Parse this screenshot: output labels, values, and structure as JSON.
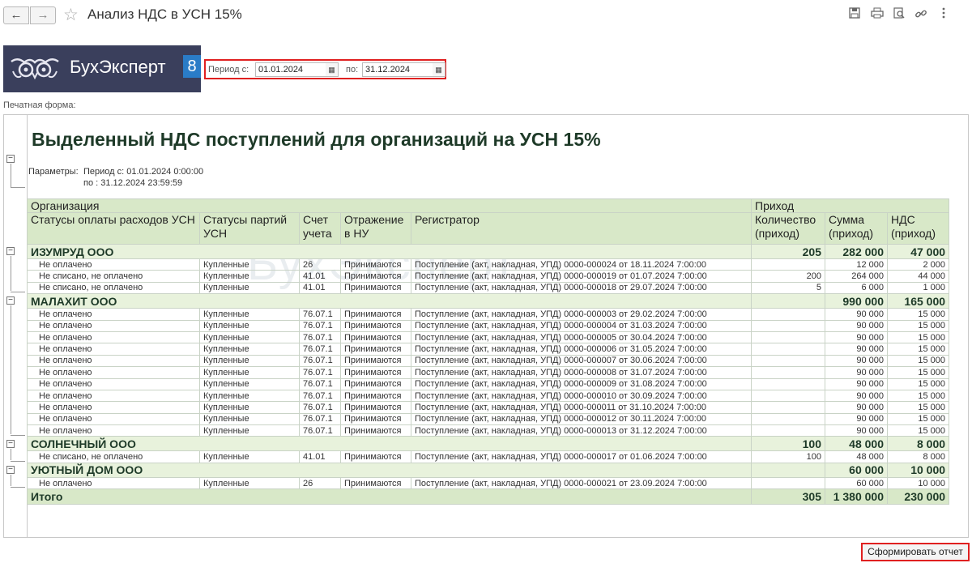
{
  "window": {
    "title": "Анализ НДС в УСН 15%",
    "back_icon": "←",
    "forward_icon": "→",
    "star_icon": "☆",
    "tools": [
      "save-icon",
      "print-icon",
      "preview-icon",
      "link-icon",
      "more-icon"
    ]
  },
  "logo": {
    "text": "БухЭксперт",
    "badge": "8"
  },
  "period": {
    "from_label": "Период с:",
    "from_value": "01.01.2024",
    "to_label": "по:",
    "to_value": "31.12.2024"
  },
  "print_form_label": "Печатная форма:",
  "report": {
    "title": "Выделенный НДС поступлений для организаций на УСН 15%",
    "params_label": "Параметры:",
    "params_line1": "Период с: 01.01.2024 0:00:00",
    "params_line2": "по : 31.12.2024 23:59:59",
    "watermark": "БухЭксперт",
    "header1": {
      "org": "Организация",
      "income": "Приход"
    },
    "header2": {
      "pay_status": "Статусы оплаты расходов УСН",
      "batch_status": "Статусы партий УСН",
      "account": "Счет учета",
      "reflected": "Отражение в НУ",
      "registrar": "Регистратор",
      "qty": "Количество (приход)",
      "sum": "Сумма (приход)",
      "vat": "НДС (приход)"
    },
    "groups": [
      {
        "name": "ИЗУМРУД ООО",
        "qty": "205",
        "sum": "282 000",
        "vat": "47 000",
        "rows": [
          [
            "Не оплачено",
            "Купленные",
            "26",
            "Принимаются",
            "Поступление (акт, накладная, УПД) 0000-000024 от 18.11.2024 7:00:00",
            "",
            "12 000",
            "2 000"
          ],
          [
            "Не списано, не оплачено",
            "Купленные",
            "41.01",
            "Принимаются",
            "Поступление (акт, накладная, УПД) 0000-000019 от 01.07.2024 7:00:00",
            "200",
            "264 000",
            "44 000"
          ],
          [
            "Не списано, не оплачено",
            "Купленные",
            "41.01",
            "Принимаются",
            "Поступление (акт, накладная, УПД) 0000-000018 от 29.07.2024 7:00:00",
            "5",
            "6 000",
            "1 000"
          ]
        ]
      },
      {
        "name": "МАЛАХИТ ООО",
        "qty": "",
        "sum": "990 000",
        "vat": "165 000",
        "rows": [
          [
            "Не оплачено",
            "Купленные",
            "76.07.1",
            "Принимаются",
            "Поступление (акт, накладная, УПД) 0000-000003 от 29.02.2024 7:00:00",
            "",
            "90 000",
            "15 000"
          ],
          [
            "Не оплачено",
            "Купленные",
            "76.07.1",
            "Принимаются",
            "Поступление (акт, накладная, УПД) 0000-000004 от 31.03.2024 7:00:00",
            "",
            "90 000",
            "15 000"
          ],
          [
            "Не оплачено",
            "Купленные",
            "76.07.1",
            "Принимаются",
            "Поступление (акт, накладная, УПД) 0000-000005 от 30.04.2024 7:00:00",
            "",
            "90 000",
            "15 000"
          ],
          [
            "Не оплачено",
            "Купленные",
            "76.07.1",
            "Принимаются",
            "Поступление (акт, накладная, УПД) 0000-000006 от 31.05.2024 7:00:00",
            "",
            "90 000",
            "15 000"
          ],
          [
            "Не оплачено",
            "Купленные",
            "76.07.1",
            "Принимаются",
            "Поступление (акт, накладная, УПД) 0000-000007 от 30.06.2024 7:00:00",
            "",
            "90 000",
            "15 000"
          ],
          [
            "Не оплачено",
            "Купленные",
            "76.07.1",
            "Принимаются",
            "Поступление (акт, накладная, УПД) 0000-000008 от 31.07.2024 7:00:00",
            "",
            "90 000",
            "15 000"
          ],
          [
            "Не оплачено",
            "Купленные",
            "76.07.1",
            "Принимаются",
            "Поступление (акт, накладная, УПД) 0000-000009 от 31.08.2024 7:00:00",
            "",
            "90 000",
            "15 000"
          ],
          [
            "Не оплачено",
            "Купленные",
            "76.07.1",
            "Принимаются",
            "Поступление (акт, накладная, УПД) 0000-000010 от 30.09.2024 7:00:00",
            "",
            "90 000",
            "15 000"
          ],
          [
            "Не оплачено",
            "Купленные",
            "76.07.1",
            "Принимаются",
            "Поступление (акт, накладная, УПД) 0000-000011 от 31.10.2024 7:00:00",
            "",
            "90 000",
            "15 000"
          ],
          [
            "Не оплачено",
            "Купленные",
            "76.07.1",
            "Принимаются",
            "Поступление (акт, накладная, УПД) 0000-000012 от 30.11.2024 7:00:00",
            "",
            "90 000",
            "15 000"
          ],
          [
            "Не оплачено",
            "Купленные",
            "76.07.1",
            "Принимаются",
            "Поступление (акт, накладная, УПД) 0000-000013 от 31.12.2024 7:00:00",
            "",
            "90 000",
            "15 000"
          ]
        ]
      },
      {
        "name": "СОЛНЕЧНЫЙ ООО",
        "qty": "100",
        "sum": "48 000",
        "vat": "8 000",
        "rows": [
          [
            "Не списано, не оплачено",
            "Купленные",
            "41.01",
            "Принимаются",
            "Поступление (акт, накладная, УПД) 0000-000017 от 01.06.2024 7:00:00",
            "100",
            "48 000",
            "8 000"
          ]
        ]
      },
      {
        "name": "УЮТНЫЙ ДОМ ООО",
        "qty": "",
        "sum": "60 000",
        "vat": "10 000",
        "rows": [
          [
            "Не оплачено",
            "Купленные",
            "26",
            "Принимаются",
            "Поступление (акт, накладная, УПД) 0000-000021 от 23.09.2024 7:00:00",
            "",
            "60 000",
            "10 000"
          ]
        ]
      }
    ],
    "total": {
      "label": "Итого",
      "qty": "305",
      "sum": "1 380 000",
      "vat": "230 000"
    }
  },
  "generate_button": "Сформировать отчет"
}
